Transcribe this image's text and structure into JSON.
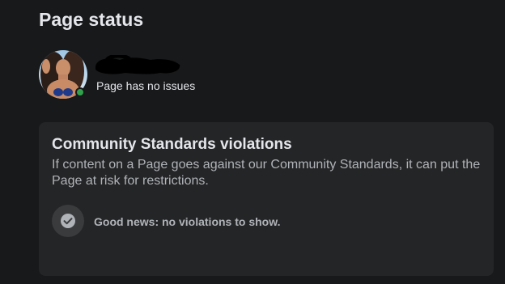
{
  "header": {
    "title": "Page status"
  },
  "profile": {
    "status_text": "Page has no issues",
    "avatar_icon": "avatar-photo",
    "online_color": "#31a24c"
  },
  "violations_card": {
    "title": "Community Standards violations",
    "description": "If content on a Page goes against our Community Standards, it can put the Page at risk for restrictions.",
    "status_icon": "checkmark-icon",
    "status_text": "Good news: no violations to show."
  },
  "colors": {
    "background": "#18191a",
    "card": "#242526",
    "primary_text": "#e4e6eb",
    "secondary_text": "#b0b3b8"
  }
}
